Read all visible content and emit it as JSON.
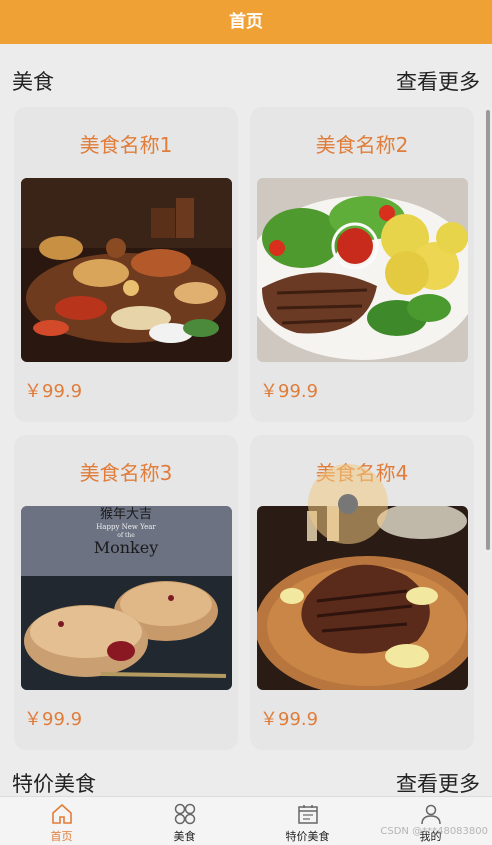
{
  "header": {
    "title": "首页"
  },
  "sections": {
    "food": {
      "title": "美食",
      "more": "查看更多"
    },
    "special": {
      "title": "特价美食",
      "more": "查看更多"
    }
  },
  "foods": [
    {
      "name": "美食名称1",
      "price": "￥99.9",
      "image": "food-feast-photo"
    },
    {
      "name": "美食名称2",
      "price": "￥99.9",
      "image": "steak-potatoes-photo"
    },
    {
      "name": "美食名称3",
      "price": "￥99.9",
      "image": "monkey-new-year-pastry-photo"
    },
    {
      "name": "美食名称4",
      "price": "￥99.9",
      "image": "grilled-steak-board-photo"
    }
  ],
  "poster_text": {
    "top": "猴年大吉",
    "line1": "Happy New Year",
    "line2": "of the",
    "line3": "Monkey"
  },
  "tabs": [
    {
      "label": "首页",
      "icon": "home-icon",
      "active": true
    },
    {
      "label": "美食",
      "icon": "clover-icon",
      "active": false
    },
    {
      "label": "特价美食",
      "icon": "calendar-icon",
      "active": false
    },
    {
      "label": "我的",
      "icon": "user-icon",
      "active": false
    }
  ],
  "watermark": "CSDN @***48083800",
  "colors": {
    "header": "#efa135",
    "accent": "#e07d3a",
    "background": "#ececec"
  }
}
